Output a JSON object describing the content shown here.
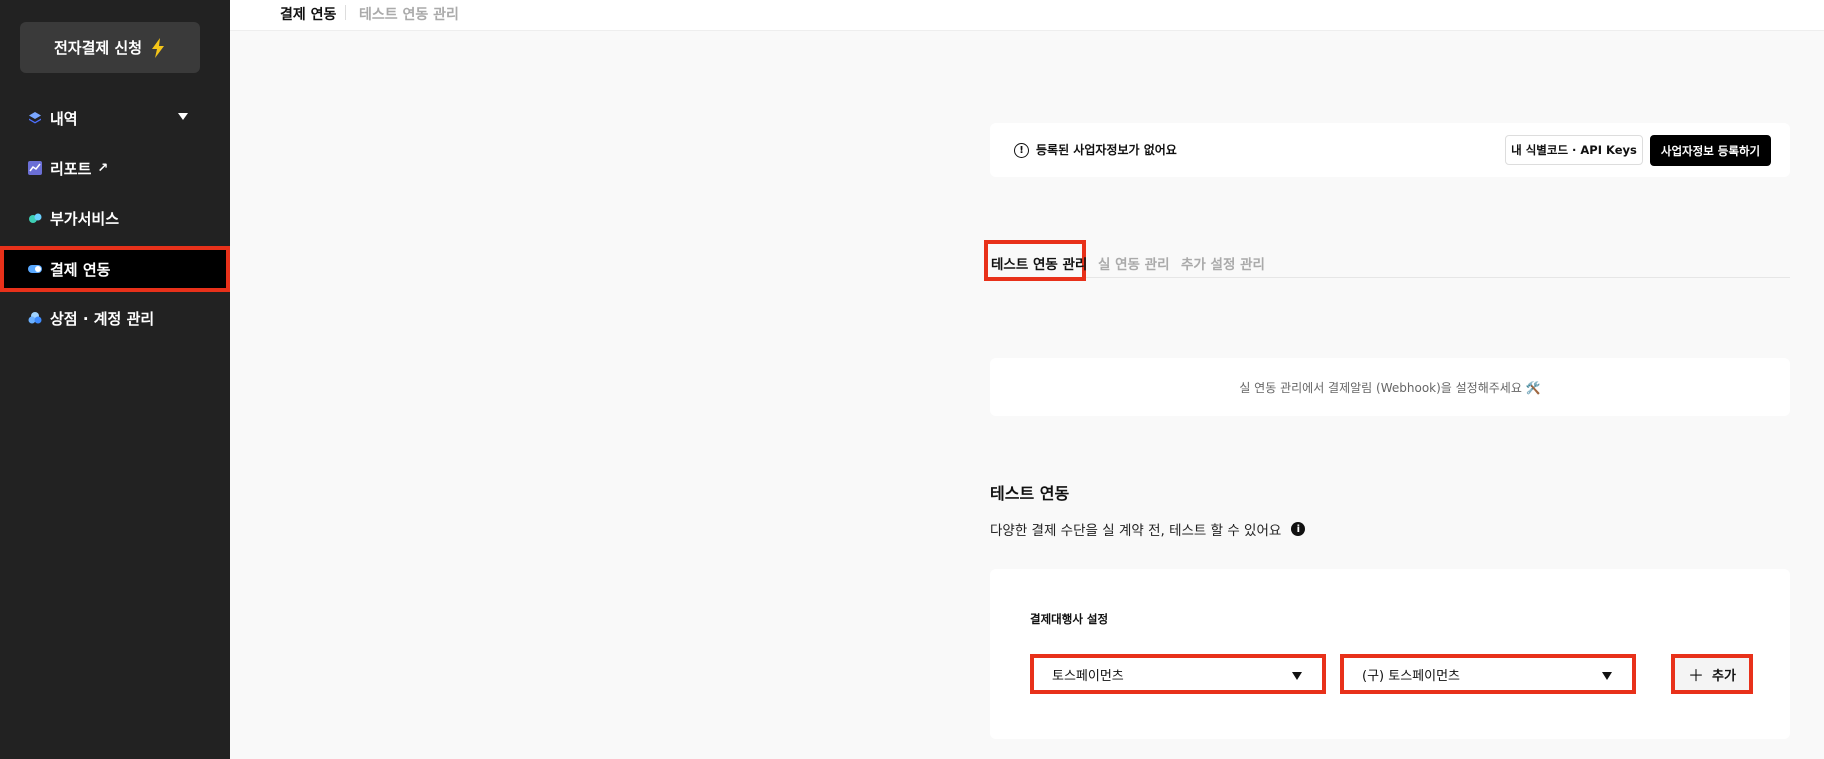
{
  "sidebar": {
    "apply_button": "전자결제 신청",
    "items": [
      {
        "label": "내역",
        "icon": "layers-icon"
      },
      {
        "label": "리포트",
        "icon": "chart-icon"
      },
      {
        "label": "부가서비스",
        "icon": "sparkle-icon"
      },
      {
        "label": "결제 연동",
        "icon": "toggle-icon"
      },
      {
        "label": "상점 · 계정 관리",
        "icon": "cloud-icon"
      }
    ],
    "report_external": "↗"
  },
  "breadcrumb": {
    "current": "결제 연동",
    "sub": "테스트 연동 관리"
  },
  "notice": {
    "text": "등록된 사업자정보가 없어요",
    "apikey_button": "내 식별코드 · API Keys",
    "register_button": "사업자정보 등록하기"
  },
  "tabs": [
    {
      "label": "테스트 연동 관리",
      "active": true
    },
    {
      "label": "실 연동 관리",
      "active": false
    },
    {
      "label": "추가 설정 관리",
      "active": false
    }
  ],
  "webhook_notice": "실 연동 관리에서 결제알림 (Webhook)을 설정해주세요 🛠️",
  "test_section": {
    "title": "테스트 연동",
    "description": "다양한 결제 수단을 실 계약 전, 테스트 할 수 있어요"
  },
  "pg_settings": {
    "label": "결제대행사 설정",
    "provider_select": "토스페이먼츠",
    "module_select": "(구) 토스페이먼츠",
    "add_button": "추가"
  },
  "colors": {
    "sidebar_bg": "#222222",
    "highlight": "#e8311a",
    "primary_button": "#000000"
  }
}
